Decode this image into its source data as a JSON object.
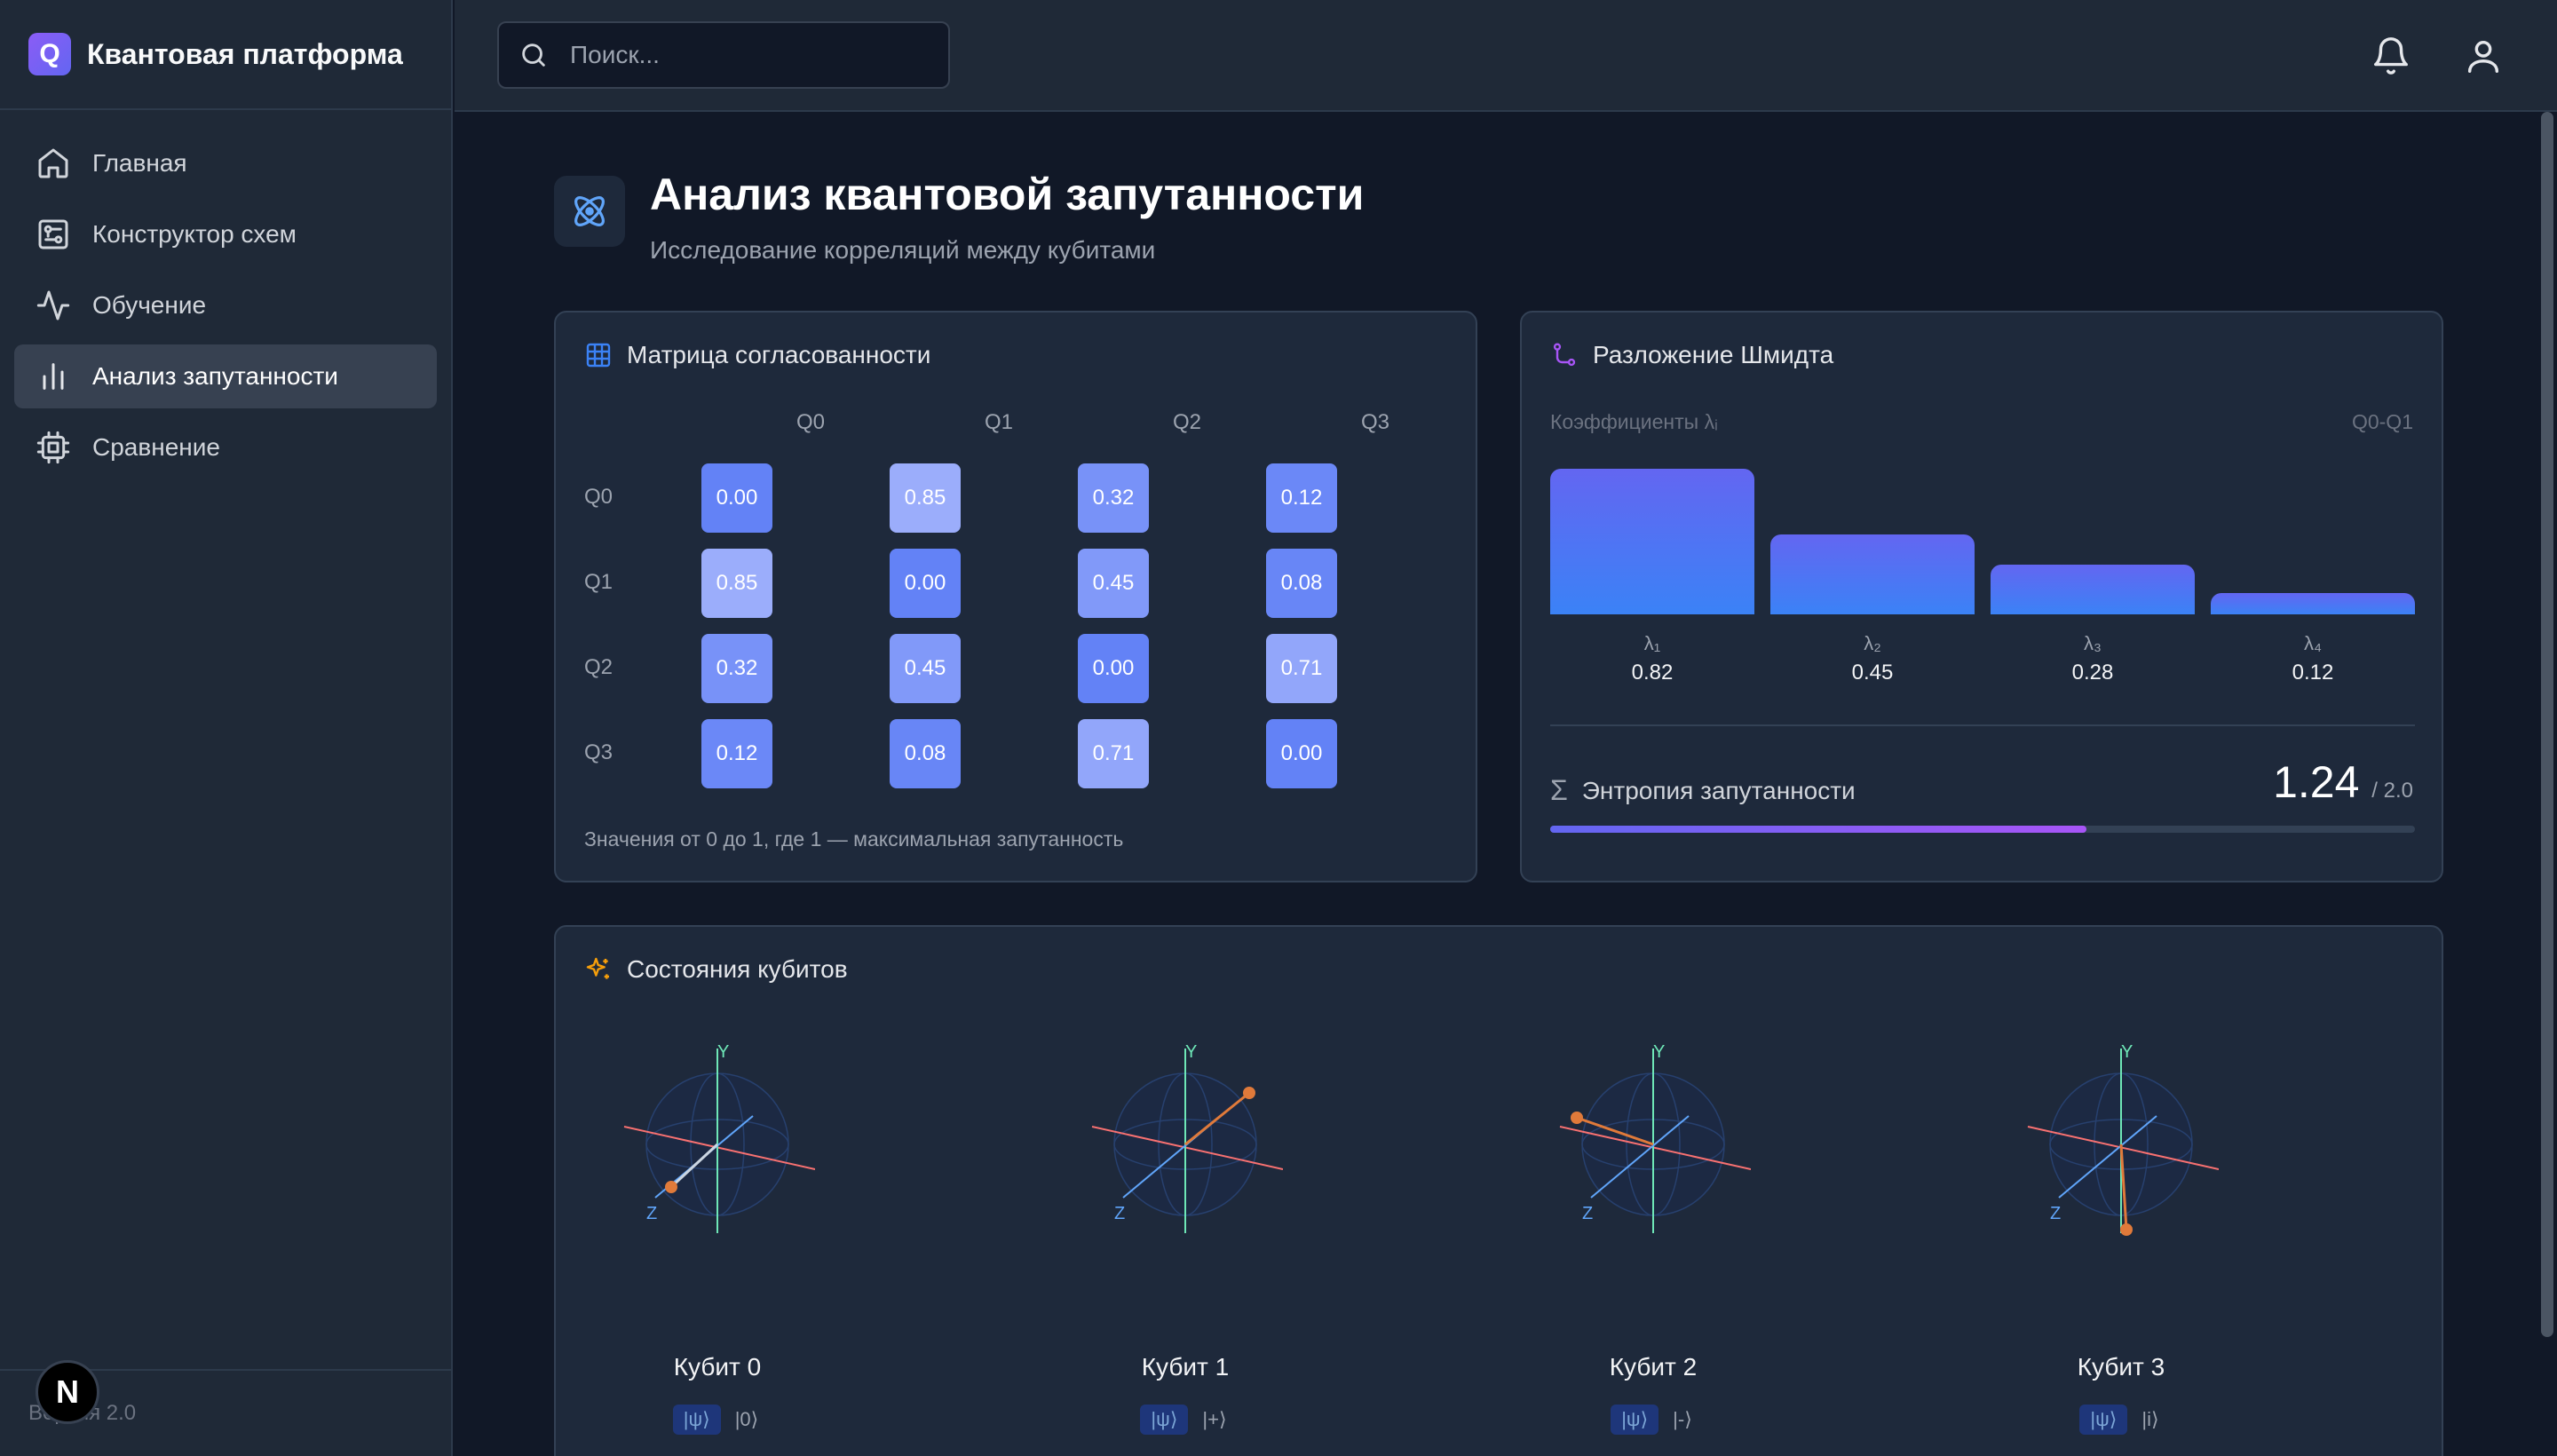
{
  "brand": {
    "logo_letter": "Q",
    "name": "Квантовая платформа"
  },
  "nav": [
    {
      "label": "Главная",
      "icon": "home-icon",
      "active": false
    },
    {
      "label": "Конструктор схем",
      "icon": "circuit-icon",
      "active": false
    },
    {
      "label": "Обучение",
      "icon": "activity-icon",
      "active": false
    },
    {
      "label": "Анализ запутанности",
      "icon": "bar-chart-icon",
      "active": true
    },
    {
      "label": "Сравнение",
      "icon": "cpu-icon",
      "active": false
    }
  ],
  "footer": {
    "version": "Версия 2.0",
    "badge": "N"
  },
  "search": {
    "placeholder": "Поиск..."
  },
  "page": {
    "title": "Анализ квантовой запутанности",
    "subtitle": "Исследование корреляций между кубитами"
  },
  "matrix": {
    "title": "Матрица согласованности",
    "labels": [
      "Q0",
      "Q1",
      "Q2",
      "Q3"
    ],
    "rows": [
      [
        "0.00",
        "0.85",
        "0.32",
        "0.12"
      ],
      [
        "0.85",
        "0.00",
        "0.45",
        "0.08"
      ],
      [
        "0.32",
        "0.45",
        "0.00",
        "0.71"
      ],
      [
        "0.12",
        "0.08",
        "0.71",
        "0.00"
      ]
    ],
    "note": "Значения от 0 до 1, где 1 — максимальная запутанность"
  },
  "schmidt": {
    "title": "Разложение Шмидта",
    "coef_label": "Коэффициенты λᵢ",
    "pair": "Q0-Q1",
    "lambdas": [
      {
        "label": "λ₁",
        "value": "0.82"
      },
      {
        "label": "λ₂",
        "value": "0.45"
      },
      {
        "label": "λ₃",
        "value": "0.28"
      },
      {
        "label": "λ₄",
        "value": "0.12"
      }
    ],
    "entropy_label": "Энтропия запутанности",
    "entropy_value": "1.24",
    "entropy_max": "/ 2.0",
    "entropy_fraction": 0.62
  },
  "qubits": {
    "title": "Состояния кубитов",
    "axis_y": "Y",
    "axis_z": "Z",
    "psi": "|ψ⟩",
    "items": [
      {
        "name": "Кубит 0",
        "state": "|0⟩"
      },
      {
        "name": "Кубит 1",
        "state": "|+⟩"
      },
      {
        "name": "Кубит 2",
        "state": "|-⟩"
      },
      {
        "name": "Кубит 3",
        "state": "|i⟩"
      }
    ]
  },
  "colors": {
    "accent": "#6366f1",
    "bar_top": "#6366f1",
    "bar_bottom": "#3b82f6",
    "vector": "#e07a3a",
    "entropy_gradient_end": "#a855f7"
  }
}
